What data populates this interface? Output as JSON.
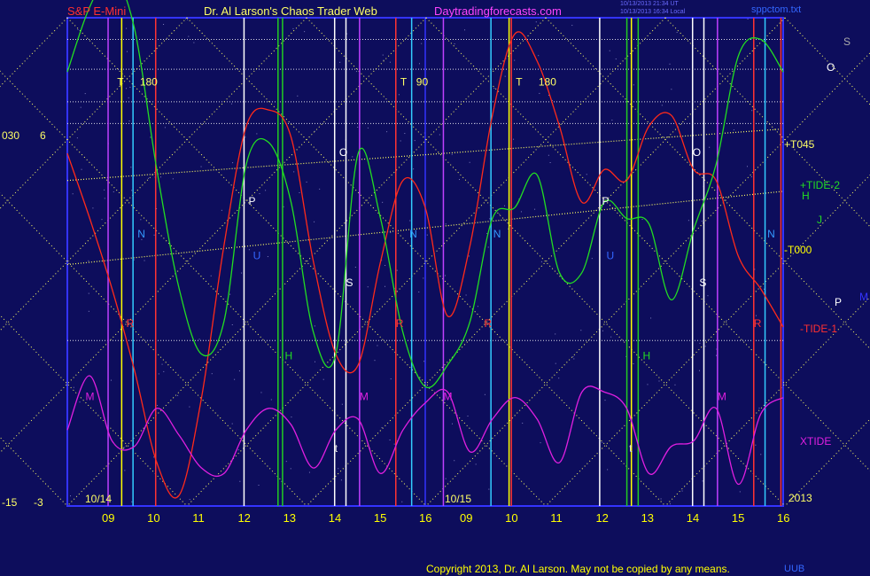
{
  "header": {
    "instrument": "S&P E-Mini",
    "title": "Dr. Al Larson's Chaos Trader Web",
    "site": "Daytradingforecasts.com",
    "stamp_line1": "10/13/2013 21:34 UT",
    "stamp_line2": "10/13/2013 16:34 Local",
    "file": "sppctom.txt"
  },
  "left_axis": {
    "top_a": "030",
    "top_b": "6",
    "bottom_a": "-15",
    "bottom_b": "-3"
  },
  "right_labels": {
    "s": "S",
    "o": "O",
    "t045": "+T045",
    "tide2": "+TIDE-2",
    "h": "H",
    "j": "J",
    "t000": "-T000",
    "p": "P",
    "m": "M",
    "tide1": "-TIDE-1",
    "xtide": "XTIDE",
    "year": "2013"
  },
  "date_labels": [
    "10/14",
    "10/15"
  ],
  "x_ticks": [
    "09",
    "10",
    "11",
    "12",
    "13",
    "14",
    "15",
    "16",
    "09",
    "10",
    "11",
    "12",
    "13",
    "14",
    "15",
    "16"
  ],
  "copyright": "Copyright 2013, Dr. Al Larson. May not be copied by any means.",
  "corner_mark": "UUB",
  "colors": {
    "background": "#0d0d5c",
    "plot_border": "#3333ff",
    "tide1": "#ff2a1a",
    "tide2": "#22dd22",
    "xtide": "#e01fe0",
    "grid_lines": "#ffff66"
  },
  "chart_data": {
    "type": "line",
    "x_ticks_hours": [
      9,
      10,
      11,
      12,
      13,
      14,
      15,
      16
    ],
    "days": [
      "10/14",
      "10/15"
    ],
    "left_scale_a": {
      "top": 30,
      "bottom": -15
    },
    "left_scale_b": {
      "top": 6,
      "bottom": -3
    },
    "series": [
      {
        "name": "-TIDE-1",
        "color": "#ff2a1a",
        "values": [
          3.5,
          2.3,
          1.0,
          -0.5,
          -2.2,
          -2.8,
          -1.0,
          1.8,
          4.0,
          4.3,
          3.8,
          1.5,
          -0.2,
          -0.4,
          1.5,
          3.0,
          2.5,
          0.5,
          1.8,
          4.2,
          5.7,
          5.2,
          4.0,
          2.6,
          3.2,
          3.0,
          4.0,
          4.2,
          3.2,
          3.0,
          1.6,
          1.0,
          0.3
        ]
      },
      {
        "name": "+TIDE-2",
        "color": "#22dd22",
        "values": [
          5.0,
          6.2,
          6.8,
          5.8,
          3.2,
          1.0,
          -0.2,
          0.4,
          3.3,
          3.7,
          2.6,
          0.2,
          -0.2,
          3.5,
          2.3,
          0.2,
          -0.8,
          -0.4,
          0.4,
          2.3,
          2.5,
          3.1,
          1.3,
          1.3,
          2.6,
          2.3,
          2.2,
          0.8,
          2.1,
          3.3,
          5.3,
          5.6,
          5.0
        ]
      },
      {
        "name": "XTIDE",
        "color": "#e01fe0",
        "values": [
          -1.6,
          -0.6,
          -1.8,
          -1.9,
          -1.2,
          -1.7,
          -2.3,
          -2.4,
          -1.6,
          -1.2,
          -1.5,
          -2.3,
          -1.6,
          -1.4,
          -2.4,
          -1.6,
          -1.1,
          -0.9,
          -2.0,
          -1.4,
          -1.0,
          -1.4,
          -2.2,
          -0.9,
          -0.9,
          -1.2,
          -2.4,
          -1.9,
          -1.8,
          -1.2,
          -2.6,
          -1.3,
          -1.0
        ]
      }
    ],
    "flux_lines": [
      {
        "day": 1,
        "hour": 9.0,
        "color": "magenta"
      },
      {
        "day": 1,
        "hour": 9.3,
        "color": "yellow"
      },
      {
        "day": 1,
        "hour": 9.55,
        "color": "cyan"
      },
      {
        "day": 1,
        "hour": 10.05,
        "color": "red"
      },
      {
        "day": 1,
        "hour": 12.0,
        "color": "white"
      },
      {
        "day": 1,
        "hour": 12.75,
        "color": "green"
      },
      {
        "day": 1,
        "hour": 12.85,
        "color": "green"
      },
      {
        "day": 1,
        "hour": 14.0,
        "color": "white"
      },
      {
        "day": 1,
        "hour": 14.25,
        "color": "white"
      },
      {
        "day": 1,
        "hour": 14.55,
        "color": "magenta"
      },
      {
        "day": 1,
        "hour": 15.35,
        "color": "red"
      },
      {
        "day": 1,
        "hour": 15.7,
        "color": "cyan"
      },
      {
        "day": 2,
        "hour": 8.5,
        "color": "magenta"
      },
      {
        "day": 2,
        "hour": 9.55,
        "color": "cyan"
      },
      {
        "day": 2,
        "hour": 9.95,
        "color": "yellow"
      },
      {
        "day": 2,
        "hour": 10.0,
        "color": "red"
      },
      {
        "day": 2,
        "hour": 11.95,
        "color": "white"
      },
      {
        "day": 2,
        "hour": 12.55,
        "color": "green"
      },
      {
        "day": 2,
        "hour": 12.65,
        "color": "yellow"
      },
      {
        "day": 2,
        "hour": 12.8,
        "color": "green"
      },
      {
        "day": 2,
        "hour": 14.0,
        "color": "white"
      },
      {
        "day": 2,
        "hour": 14.25,
        "color": "white"
      },
      {
        "day": 2,
        "hour": 14.55,
        "color": "magenta"
      },
      {
        "day": 2,
        "hour": 15.35,
        "color": "red"
      },
      {
        "day": 2,
        "hour": 15.6,
        "color": "cyan"
      },
      {
        "day": 2,
        "hour": 15.95,
        "color": "red"
      }
    ],
    "markers": [
      {
        "text": "T",
        "day": 1,
        "hour": 9.2,
        "y": 4.75,
        "color": "#ffff66"
      },
      {
        "text": "180",
        "day": 1,
        "hour": 9.7,
        "y": 4.75,
        "color": "#ffff66"
      },
      {
        "text": "T",
        "day": 1,
        "hour": 15.45,
        "y": 4.75,
        "color": "#ffff66"
      },
      {
        "text": "90",
        "day": 1,
        "hour": 15.8,
        "y": 4.75,
        "color": "#ffff66"
      },
      {
        "text": "T",
        "day": 2,
        "hour": 10.1,
        "y": 4.75,
        "color": "#ffff66"
      },
      {
        "text": "180",
        "day": 2,
        "hour": 10.6,
        "y": 4.75,
        "color": "#ffff66"
      },
      {
        "text": "N",
        "day": 1,
        "hour": 9.65,
        "y": 1.95,
        "color": "#3399ff"
      },
      {
        "text": "N",
        "day": 1,
        "hour": 15.65,
        "y": 1.95,
        "color": "#3399ff"
      },
      {
        "text": "N",
        "day": 2,
        "hour": 9.6,
        "y": 1.95,
        "color": "#3399ff"
      },
      {
        "text": "N",
        "day": 2,
        "hour": 15.65,
        "y": 1.95,
        "color": "#3399ff"
      },
      {
        "text": "P",
        "day": 1,
        "hour": 12.1,
        "y": 2.55,
        "color": "#ffffff"
      },
      {
        "text": "P",
        "day": 2,
        "hour": 12.0,
        "y": 2.55,
        "color": "#ffffff"
      },
      {
        "text": "O",
        "day": 1,
        "hour": 14.1,
        "y": 3.45,
        "color": "#ffffff"
      },
      {
        "text": "O",
        "day": 2,
        "hour": 14.0,
        "y": 3.45,
        "color": "#ffffff"
      },
      {
        "text": "S",
        "day": 1,
        "hour": 14.25,
        "y": 1.05,
        "color": "#ffffff"
      },
      {
        "text": "S",
        "day": 2,
        "hour": 14.15,
        "y": 1.05,
        "color": "#ffffff"
      },
      {
        "text": "H",
        "day": 1,
        "hour": 12.9,
        "y": -0.3,
        "color": "#22dd22"
      },
      {
        "text": "H",
        "day": 2,
        "hour": 12.9,
        "y": -0.3,
        "color": "#22dd22"
      },
      {
        "text": "M",
        "day": 1,
        "hour": 8.5,
        "y": -1.05,
        "color": "#e01fe0"
      },
      {
        "text": "M",
        "day": 1,
        "hour": 14.55,
        "y": -1.05,
        "color": "#e01fe0"
      },
      {
        "text": "M",
        "day": 2,
        "hour": 8.5,
        "y": -1.05,
        "color": "#e01fe0"
      },
      {
        "text": "M",
        "day": 2,
        "hour": 14.55,
        "y": -1.05,
        "color": "#e01fe0"
      },
      {
        "text": "U",
        "day": 1,
        "hour": 12.2,
        "y": 1.55,
        "color": "#3366ff"
      },
      {
        "text": "U",
        "day": 2,
        "hour": 12.1,
        "y": 1.55,
        "color": "#3366ff"
      },
      {
        "text": "R",
        "day": 1,
        "hour": 9.4,
        "y": 0.3,
        "color": "#ff3333"
      },
      {
        "text": "R",
        "day": 1,
        "hour": 15.35,
        "y": 0.3,
        "color": "#ff3333"
      },
      {
        "text": "R",
        "day": 2,
        "hour": 9.4,
        "y": 0.3,
        "color": "#ff3333"
      },
      {
        "text": "R",
        "day": 2,
        "hour": 15.35,
        "y": 0.3,
        "color": "#ff3333"
      },
      {
        "text": "t",
        "day": 1,
        "hour": 14.0,
        "y": -2.0,
        "color": "#dddddd"
      },
      {
        "text": "t",
        "day": 2,
        "hour": 12.6,
        "y": -2.0,
        "color": "#dddddd"
      }
    ],
    "horizontal_levels": [
      5.6,
      5.05,
      4.45,
      4.05,
      0.05
    ],
    "price_lines": [
      {
        "label": "+T045",
        "from": [
          0,
          3.0
        ],
        "to": [
          1,
          3.95
        ],
        "color": "#ffff66"
      },
      {
        "label": "-T000",
        "from": [
          0,
          1.45
        ],
        "to": [
          1,
          2.8
        ],
        "color": "#ffff66"
      }
    ]
  }
}
